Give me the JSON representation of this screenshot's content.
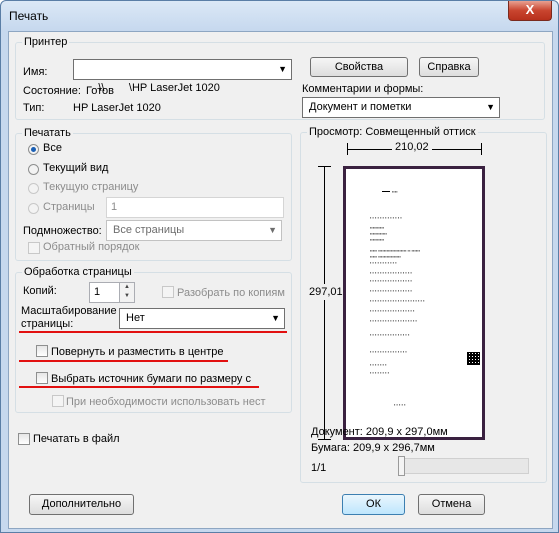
{
  "window": {
    "title": "Печать",
    "close_glyph": "X"
  },
  "printer": {
    "group_label": "Принтер",
    "name_label": "Имя:",
    "name_value": "\\\\        \\HP LaserJet 1020",
    "status_label": "Состояние:",
    "status_value": "Готов",
    "type_label": "Тип:",
    "type_value": "HP LaserJet 1020",
    "properties_button": "Свойства",
    "help_button": "Справка",
    "comments_label": "Комментарии и формы:",
    "comments_value": "Документ и пометки"
  },
  "print_range": {
    "group_label": "Печатать",
    "options": [
      "Все",
      "Текущий вид",
      "Текущую страницу",
      "Страницы"
    ],
    "selected": "Все",
    "pages_value": "1",
    "subset_label": "Подмножество:",
    "subset_value": "Все страницы",
    "reverse_label": "Обратный порядок"
  },
  "handling": {
    "group_label": "Обработка страницы",
    "copies_label": "Копий:",
    "copies_value": "1",
    "collate_label": "Разобрать по копиям",
    "scaling_label_line1": "Масштабирование",
    "scaling_label_line2": "страницы:",
    "scaling_value": "Нет",
    "rotate_label": "Повернуть и разместить в центре",
    "paper_source_label": "Выбрать источник бумаги по размеру с",
    "custom_size_label": "При необходимости использовать нест"
  },
  "print_to_file_label": "Печатать в файл",
  "preview": {
    "title": "Просмотр: Совмещенный оттиск",
    "width_label": "210,02",
    "height_label": "297,01",
    "document_size": "Документ: 209,9 x 297,0мм",
    "paper_size": "Бумага: 209,9 x 296,7мм",
    "page_counter": "1/1"
  },
  "buttons": {
    "advanced": "Дополнительно",
    "ok": "ОК",
    "cancel": "Отмена"
  },
  "colors": {
    "accent": "#3c7fb1",
    "annotation_red": "#e21010",
    "preview_border": "#3a2140"
  }
}
